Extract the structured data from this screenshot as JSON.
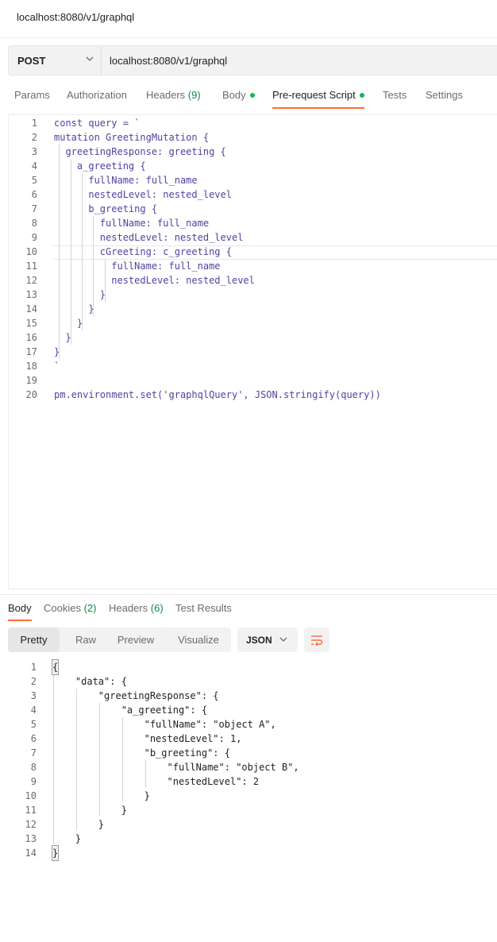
{
  "window": {
    "title": "localhost:8080/v1/graphql"
  },
  "request": {
    "method": "POST",
    "url": "localhost:8080/v1/graphql"
  },
  "tabs": [
    {
      "label": "Params"
    },
    {
      "label": "Authorization"
    },
    {
      "label": "Headers",
      "count": "(9)"
    },
    {
      "label": "Body"
    },
    {
      "label": "Pre-request Script"
    },
    {
      "label": "Tests"
    },
    {
      "label": "Settings"
    }
  ],
  "script_lines": [
    {
      "n": "1",
      "text": "const query = `"
    },
    {
      "n": "2",
      "text": "mutation GreetingMutation {"
    },
    {
      "n": "3",
      "text": "  greetingResponse: greeting {"
    },
    {
      "n": "4",
      "text": "    a_greeting {"
    },
    {
      "n": "5",
      "text": "      fullName: full_name"
    },
    {
      "n": "6",
      "text": "      nestedLevel: nested_level"
    },
    {
      "n": "7",
      "text": "      b_greeting {"
    },
    {
      "n": "8",
      "text": "        fullName: full_name"
    },
    {
      "n": "9",
      "text": "        nestedLevel: nested_level"
    },
    {
      "n": "10",
      "text": "        cGreeting: c_greeting {"
    },
    {
      "n": "11",
      "text": "          fullName: full_name"
    },
    {
      "n": "12",
      "text": "          nestedLevel: nested_level"
    },
    {
      "n": "13",
      "text": "        }"
    },
    {
      "n": "14",
      "text": "      }"
    },
    {
      "n": "15",
      "text": "    }"
    },
    {
      "n": "16",
      "text": "  }"
    },
    {
      "n": "17",
      "text": "}"
    },
    {
      "n": "18",
      "text": "`"
    },
    {
      "n": "19",
      "text": ""
    },
    {
      "n": "20",
      "text": "pm.environment.set('graphqlQuery', JSON.stringify(query))"
    }
  ],
  "response_tabs": [
    {
      "label": "Body"
    },
    {
      "label": "Cookies",
      "count": "(2)"
    },
    {
      "label": "Headers",
      "count": "(6)"
    },
    {
      "label": "Test Results"
    }
  ],
  "view_modes": [
    "Pretty",
    "Raw",
    "Preview",
    "Visualize"
  ],
  "active_view_mode": "Pretty",
  "format": "JSON",
  "response_lines": [
    {
      "n": "1",
      "text": "{"
    },
    {
      "n": "2",
      "text": "    \"data\": {"
    },
    {
      "n": "3",
      "text": "        \"greetingResponse\": {"
    },
    {
      "n": "4",
      "text": "            \"a_greeting\": {"
    },
    {
      "n": "5",
      "text": "                \"fullName\": \"object A\","
    },
    {
      "n": "6",
      "text": "                \"nestedLevel\": 1,"
    },
    {
      "n": "7",
      "text": "                \"b_greeting\": {"
    },
    {
      "n": "8",
      "text": "                    \"fullName\": \"object B\","
    },
    {
      "n": "9",
      "text": "                    \"nestedLevel\": 2"
    },
    {
      "n": "10",
      "text": "                }"
    },
    {
      "n": "11",
      "text": "            }"
    },
    {
      "n": "12",
      "text": "        }"
    },
    {
      "n": "13",
      "text": "    }"
    },
    {
      "n": "14",
      "text": "}"
    }
  ],
  "icons": {
    "method_dropdown": "chevron-down-icon",
    "format_dropdown": "chevron-down-icon",
    "wrap": "wrap-lines-icon"
  },
  "colors": {
    "accent": "#ff6c37",
    "status_dot": "#0cbb52",
    "count": "#0f8c48"
  }
}
